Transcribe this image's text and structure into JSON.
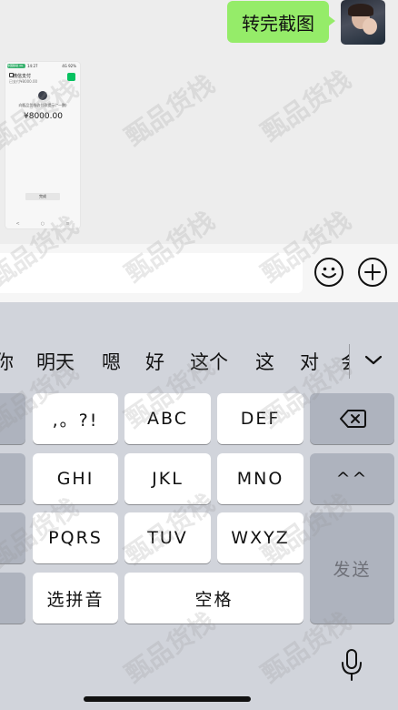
{
  "chat": {
    "sent_message": "转完截图",
    "screenshot": {
      "status_left": "中国移动 4G",
      "status_time": "14:27",
      "status_right": "4G 92%",
      "pay_title": "微信支付",
      "pay_subtitle": "已支付¥8000.00",
      "receiver_text": "向甄品货栈收付款提示(*一鹏)",
      "amount": "¥8000.00",
      "return_label": "完成",
      "nav": [
        "<",
        "○",
        "≡"
      ]
    }
  },
  "input_bar": {
    "placeholder": "",
    "emoji_icon": "smiley-icon",
    "plus_icon": "plus-icon"
  },
  "keyboard": {
    "candidates": [
      "你",
      "明天",
      "嗯",
      "好",
      "这个",
      "这",
      "对",
      "会"
    ],
    "keys": {
      "punct": ",。?!",
      "abc": "ABC",
      "def": "DEF",
      "ghi": "GHI",
      "jkl": "JKL",
      "mno": "MNO",
      "pqrs": "PQRS",
      "tuv": "TUV",
      "wxyz": "WXYZ",
      "pinyin": "选拼音",
      "space": "空格",
      "send": "发送",
      "tone": "^^"
    }
  },
  "watermark": "甄品货栈",
  "colors": {
    "bubble": "#95ec69",
    "wechat_green": "#07c160",
    "keyboard_bg": "#d1d4db"
  }
}
